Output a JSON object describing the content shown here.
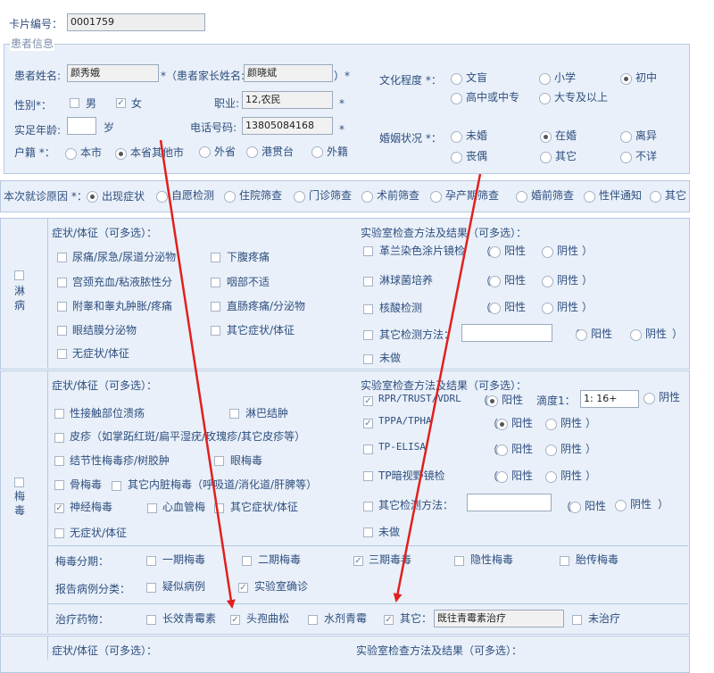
{
  "card": {
    "label": "卡片编号：",
    "value": "0001759"
  },
  "patient_section": {
    "title": "患者信息",
    "name_label": "患者姓名:",
    "name_value": "颜秀娥",
    "guardian_label": "*（患者家长姓名:",
    "guardian_value": "颜晓斌",
    "guardian_suffix": "）*",
    "sex_label": "性别*：",
    "male": "男",
    "female": "女",
    "job_label": "职业:",
    "job_value": "12,农民",
    "age_label": "实足年龄:",
    "age_value": "",
    "age_unit": "岁",
    "phone_label": "电话号码:",
    "phone_value": "13805084168",
    "reg_label": "户籍 *：",
    "reg_options": [
      "本市",
      "本省其他市",
      "外省",
      "港贯台",
      "外籍"
    ],
    "edu_label": "文化程度 *：",
    "edu_options": [
      "文盲",
      "小学",
      "初中",
      "高中或中专",
      "大专及以上"
    ],
    "marriage_label": "婚姻状况 *：",
    "marriage_options": [
      "未婚",
      "在婚",
      "离异",
      "丧偶",
      "其它",
      "不详"
    ],
    "star": "*"
  },
  "visit_reason": {
    "label": "本次就诊原因 *：",
    "options": [
      "出现症状",
      "自愿检测",
      "住院筛查",
      "门诊筛查",
      "术前筛查",
      "孕产期筛查",
      "婚前筛查",
      "性伴通知",
      "其它"
    ]
  },
  "gonorrhea": {
    "title": "淋病",
    "symptoms_title": "症状/体征（可多选）：",
    "symptoms": [
      "尿痛/尿急/尿道分泌物",
      "下腹疼痛",
      "宫颈充血/粘液脓性分",
      "咽部不适",
      "附睾和睾丸肿胀/疼痛",
      "直肠疼痛/分泌物",
      "眼结膜分泌物",
      "其它症状/体征",
      "无症状/体征"
    ],
    "lab_title": "实验室检查方法及结果（可多选）：",
    "lab_items": [
      "革兰染色涂片镜检",
      "淋球菌培养",
      "核酸检测",
      "其它检测方法：",
      "未做"
    ],
    "positive": "阳性",
    "negative": "阴性",
    "paren_open": "（",
    "paren_close": "）"
  },
  "syphilis": {
    "title": "梅毒",
    "symptoms_title": "症状/体征（可多选）：",
    "symptoms": [
      "性接触部位溃疡",
      "淋巴结肿",
      "皮疹（如掌跖红斑/扁平湿疣/玫瑰疹/其它皮疹等）",
      "结节性梅毒疹/树胶肿",
      "眼梅毒",
      "骨梅毒",
      "其它内脏梅毒（呼吸道/消化道/肝脾等）",
      "神经梅毒",
      "心血管梅",
      "其它症状/体征",
      "无症状/体征"
    ],
    "lab_title": "实验室检查方法及结果（可多选）：",
    "lab_items": [
      "RPR/TRUST/VDRL",
      "TPPA/TPHA",
      "TP-ELISA",
      "TP暗视野镜检",
      "其它检测方法：",
      "未做"
    ],
    "titer_label": "滴度1：",
    "titer_value": "1: 16+",
    "positive": "阳性",
    "negative": "阴性",
    "stage_label": "梅毒分期：",
    "stages": [
      "一期梅毒",
      "二期梅毒",
      "三期毒毒",
      "隐性梅毒",
      "胎传梅毒"
    ],
    "report_label": "报告病例分类：",
    "report_options": [
      "疑似病例",
      "实验室确诊"
    ],
    "drug_label": "治疗药物：",
    "drugs": [
      "长效青霉素",
      "头孢曲松",
      "水剂青霉",
      "其它：",
      "未治疗"
    ],
    "drug_other_value": "既往青霉素治疗"
  },
  "next_section": {
    "symptoms_title": "症状/体征（可多选）：",
    "lab_title": "实验室检查方法及结果（可多选）："
  },
  "colors": {
    "panel": "#e9f0f9",
    "border": "#b7c8e2",
    "text": "#2f4f7f",
    "arrow": "#e0201e"
  }
}
